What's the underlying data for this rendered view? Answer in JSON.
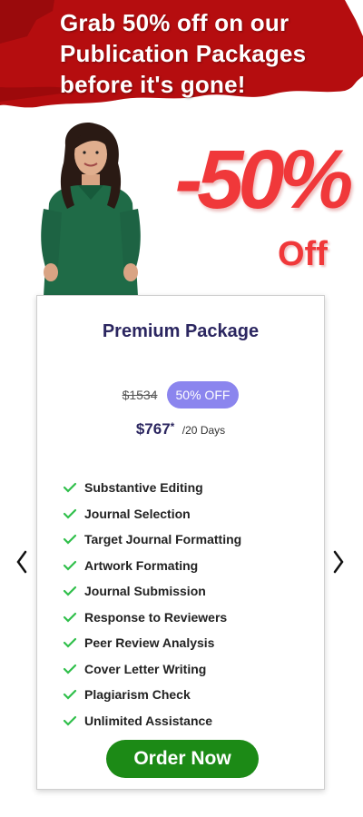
{
  "banner": {
    "line1": "Grab 50% off on our",
    "line2": "Publication Packages",
    "line3": "before it's gone!"
  },
  "discount": {
    "amount": "-50%",
    "off_label": "Off"
  },
  "package": {
    "title": "Premium Package",
    "old_price": "$1534",
    "off_badge": "50% OFF",
    "price": "$767",
    "asterisk": "*",
    "duration": "/20 Days",
    "features": [
      "Substantive Editing",
      "Journal Selection",
      "Target Journal Formatting",
      "Artwork Formating",
      "Journal Submission",
      "Response to Reviewers",
      "Peer Review Analysis",
      "Cover Letter Writing",
      "Plagiarism Check",
      "Unlimited Assistance"
    ],
    "order_button": "Order Now"
  },
  "colors": {
    "banner_red": "#b50d0f",
    "accent_purple": "#8b85ee",
    "title_navy": "#2b2660",
    "check_green": "#2fbf4a",
    "button_green": "#1c8a16",
    "discount_red": "#f0383a"
  },
  "icons": {
    "prev": "chevron-left-icon",
    "next": "chevron-right-icon",
    "check": "check-icon"
  }
}
